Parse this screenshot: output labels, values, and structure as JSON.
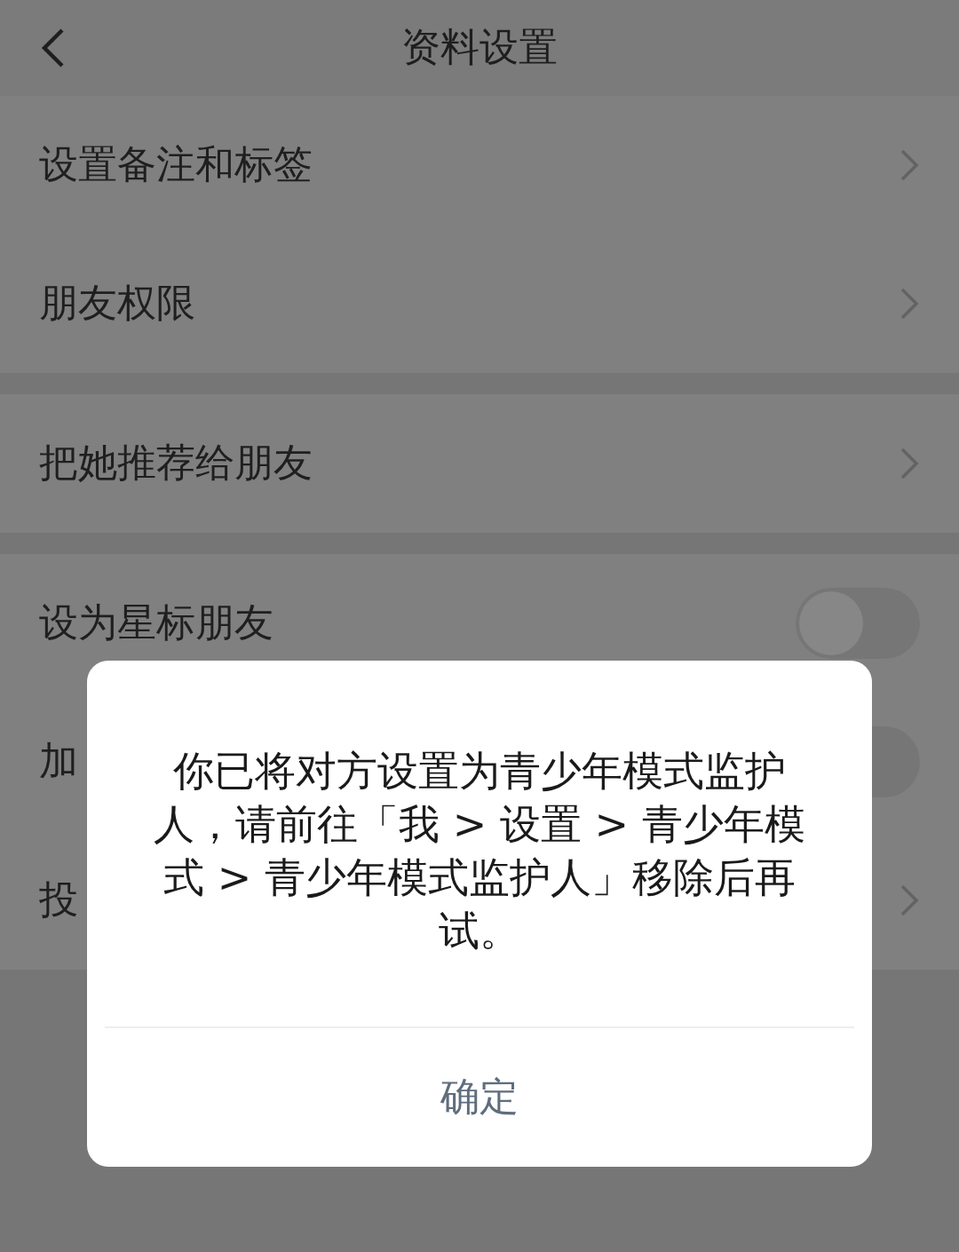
{
  "header": {
    "title": "资料设置"
  },
  "groups": [
    {
      "rows": [
        {
          "kind": "link",
          "label": "设置备注和标签"
        },
        {
          "kind": "link",
          "label": "朋友权限"
        }
      ]
    },
    {
      "rows": [
        {
          "kind": "link",
          "label": "把她推荐给朋友"
        }
      ]
    },
    {
      "rows": [
        {
          "kind": "toggle",
          "label": "设为星标朋友",
          "on": false
        },
        {
          "kind": "toggle",
          "label": "加",
          "on": false
        },
        {
          "kind": "link",
          "label": "投"
        }
      ]
    }
  ],
  "dialog": {
    "message": "你已将对方设置为青少年模式监护人，请前往「我 > 设置 > 青少年模式 > 青少年模式监护人」移除后再试。",
    "buttons": [
      "确定"
    ]
  }
}
